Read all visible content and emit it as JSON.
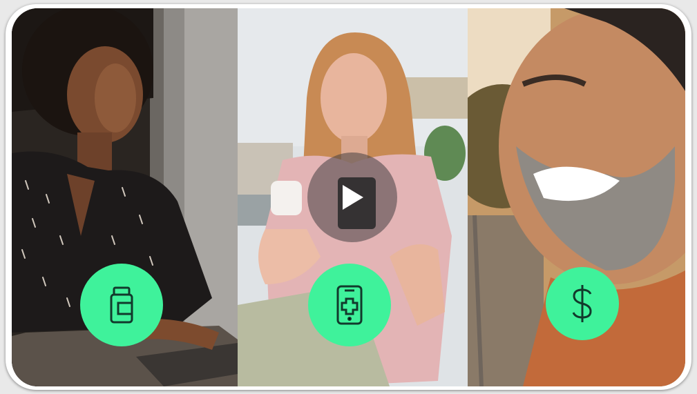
{
  "video": {
    "panels": [
      {
        "subject": "woman-at-laptop",
        "icon": "medicine-bottle-icon"
      },
      {
        "subject": "woman-with-pill-bottle-and-phone",
        "icon": "phone-medical-cross-icon"
      },
      {
        "subject": "smiling-bearded-man",
        "icon": "dollar-sign-icon"
      }
    ],
    "play_icon": "play-icon"
  },
  "colors": {
    "badge": "#3ff29b",
    "badge_icon": "#123a2c",
    "frame_border": "#ffffff",
    "play_overlay": "rgba(70,64,66,0.55)"
  }
}
